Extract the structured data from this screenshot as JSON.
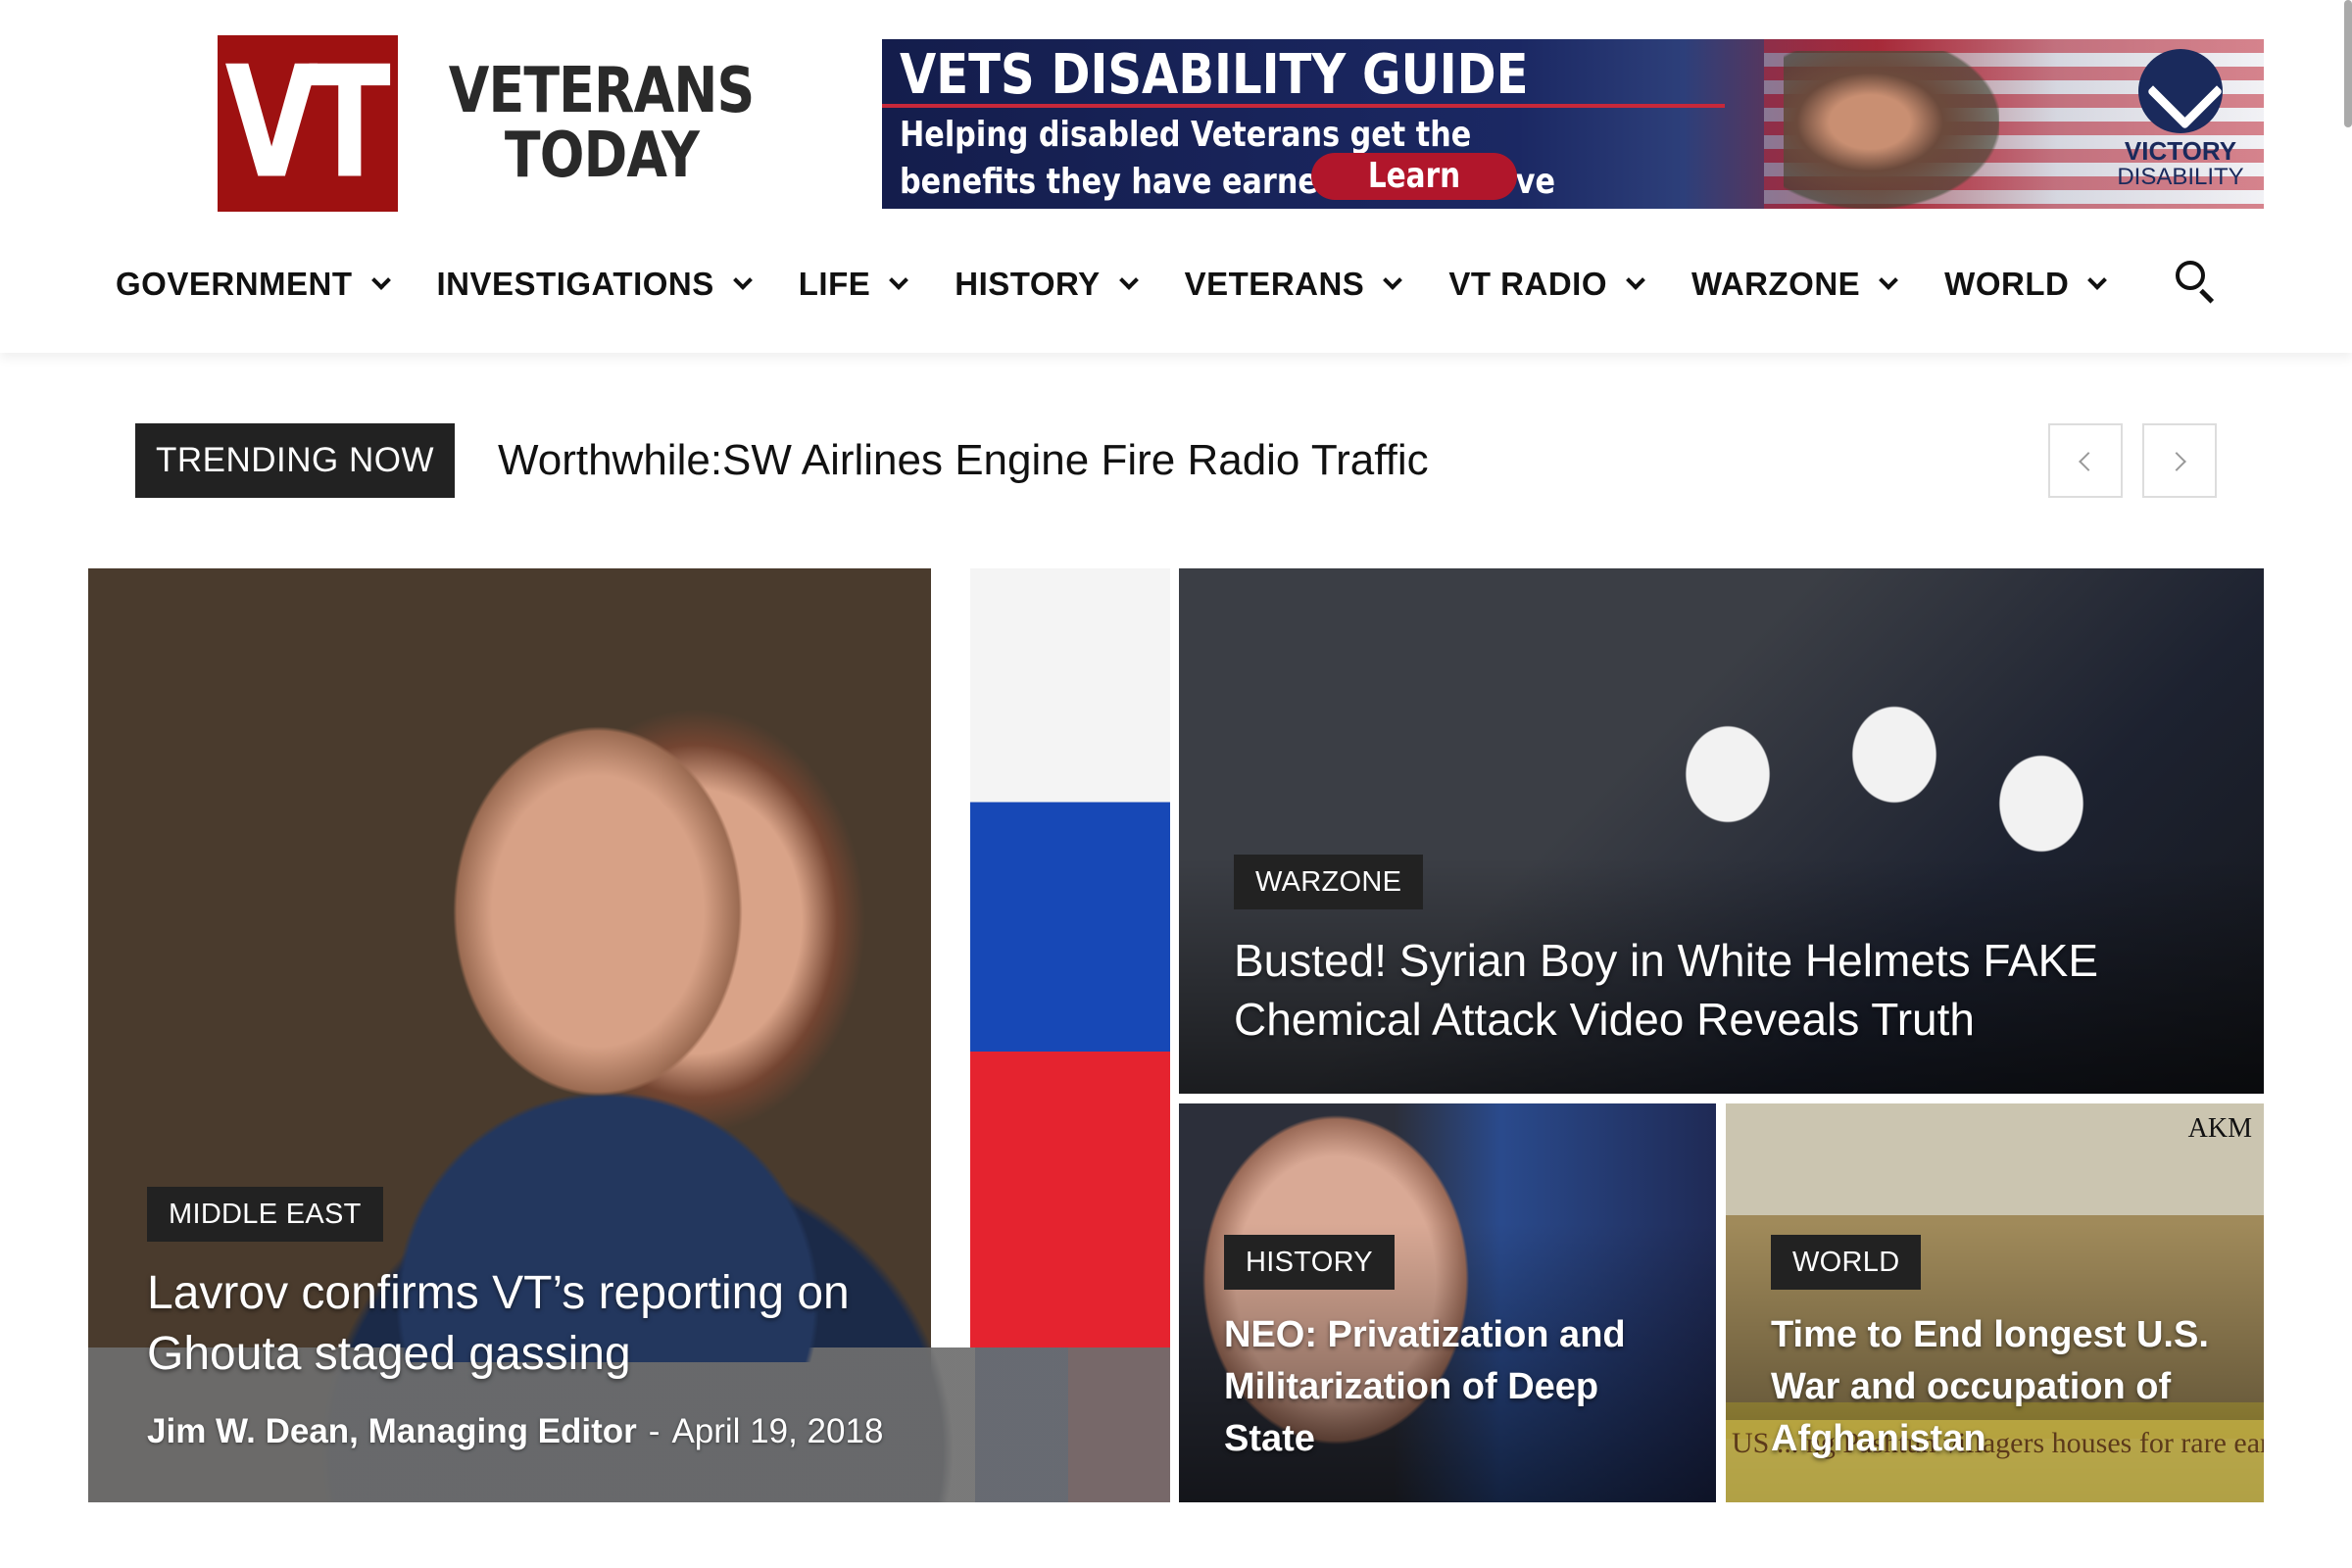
{
  "logo": {
    "mark": "VT",
    "line1": "VETERANS",
    "line2": "TODAY"
  },
  "ad": {
    "title": "VETS DISABILITY GUIDE",
    "body": "Helping disabled Veterans get the benefits they have earned and deserve",
    "cta": "Learn More",
    "brand_line1": "VICTORY",
    "brand_line2": "DISABILITY"
  },
  "nav": {
    "items": [
      {
        "label": "GOVERNMENT"
      },
      {
        "label": "INVESTIGATIONS"
      },
      {
        "label": "LIFE"
      },
      {
        "label": "HISTORY"
      },
      {
        "label": "VETERANS"
      },
      {
        "label": "VT RADIO"
      },
      {
        "label": "WARZONE"
      },
      {
        "label": "WORLD"
      }
    ],
    "search_icon": "search-icon"
  },
  "trending": {
    "tag": "TRENDING NOW",
    "headline": "Worthwhile:SW Airlines Engine Fire Radio Traffic",
    "prev_icon": "chevron-left-icon",
    "next_icon": "chevron-right-icon"
  },
  "features": {
    "main": {
      "category": "MIDDLE EAST",
      "headline": "Lavrov confirms VT’s reporting on Ghouta staged gassing",
      "author": "Jim W. Dean, Managing Editor",
      "separator": "-",
      "date": "April 19, 2018"
    },
    "warzone": {
      "category": "WARZONE",
      "headline": "Busted! Syrian Boy in White Helmets FAKE Chemical Attack Video Reveals Truth"
    },
    "history": {
      "category": "HISTORY",
      "headline": "NEO: Privatization and Militarization of Deep State"
    },
    "world": {
      "category": "WORLD",
      "headline": "Time to End longest U.S. War and occupation of Afghanistan",
      "image_label": "AKM",
      "image_caption": "US ... ng Pashtun villagers houses for rare earth elements(REEs)"
    }
  },
  "colors": {
    "brand_red": "#9e1111",
    "tag_background": "#222222",
    "ad_navy": "#1b2863",
    "ad_cta": "#b1162b"
  }
}
